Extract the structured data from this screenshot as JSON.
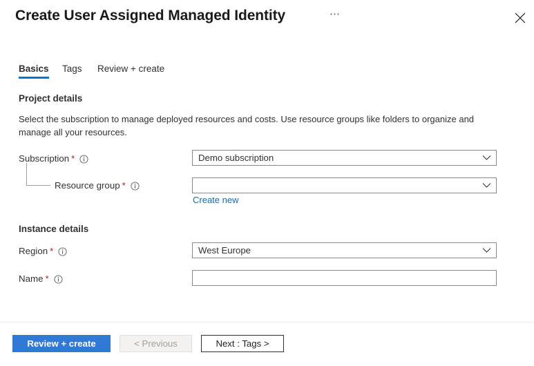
{
  "header": {
    "title": "Create User Assigned Managed Identity",
    "ellipsis_label": "⋯",
    "close_icon": "close-icon",
    "more_icon": "ellipsis-icon"
  },
  "tabs": [
    {
      "label": "Basics",
      "selected": true
    },
    {
      "label": "Tags",
      "selected": false
    },
    {
      "label": "Review + create",
      "selected": false
    }
  ],
  "sections": {
    "project_details": {
      "title": "Project details",
      "description": "Select the subscription to manage deployed resources and costs. Use resource groups like folders to organize and manage all your resources."
    },
    "instance_details": {
      "title": "Instance details"
    }
  },
  "fields": {
    "subscription": {
      "label": "Subscription",
      "required_marker": "*",
      "info_icon": "info-icon",
      "value": "Demo subscription",
      "placeholder": "",
      "chevron_icon": "chevron-down-icon"
    },
    "resource_group": {
      "label": "Resource group",
      "required_marker": "*",
      "info_icon": "info-icon",
      "value": "",
      "placeholder": "",
      "chevron_icon": "chevron-down-icon",
      "create_new_link": "Create new"
    },
    "region": {
      "label": "Region",
      "required_marker": "*",
      "info_icon": "info-icon",
      "value": "West Europe",
      "placeholder": "",
      "chevron_icon": "chevron-down-icon"
    },
    "name": {
      "label": "Name",
      "required_marker": "*",
      "info_icon": "info-icon",
      "value": "",
      "placeholder": ""
    }
  },
  "footer": {
    "review_create_label": "Review + create",
    "previous_label": "< Previous",
    "next_label": "Next : Tags >"
  },
  "colors": {
    "accent_blue": "#0078d4",
    "primary_button": "#3079d6",
    "link_blue": "#0f6cbd",
    "required_red": "#a4262c",
    "border_gray": "#8a8886",
    "disabled_text": "#a19f9d"
  }
}
